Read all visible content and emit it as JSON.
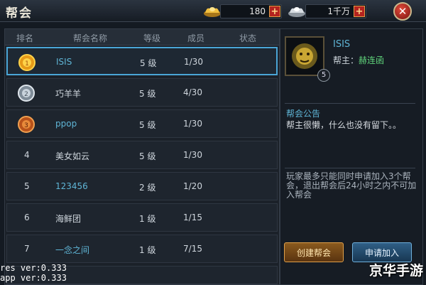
{
  "title": "帮会",
  "currency": {
    "gold": "180",
    "silver": "1千万",
    "plus_symbol": "+"
  },
  "close_symbol": "✕",
  "table": {
    "headers": [
      "排名",
      "帮会名称",
      "等级",
      "成员",
      "状态"
    ],
    "rows": [
      {
        "rank": "1",
        "name": "ISIS",
        "level": "5 级",
        "members": "1/30",
        "medal": "gold",
        "name_color": "cyan"
      },
      {
        "rank": "2",
        "name": "巧羊羊",
        "level": "5 级",
        "members": "4/30",
        "medal": "silver",
        "name_color": "white"
      },
      {
        "rank": "3",
        "name": "ppop",
        "level": "5 级",
        "members": "1/30",
        "medal": "bronze",
        "name_color": "cyan"
      },
      {
        "rank": "4",
        "name": "美女如云",
        "level": "5 级",
        "members": "1/30",
        "medal": "",
        "name_color": "white"
      },
      {
        "rank": "5",
        "name": "123456",
        "level": "2 级",
        "members": "1/20",
        "medal": "",
        "name_color": "cyan"
      },
      {
        "rank": "6",
        "name": "海鲜团",
        "level": "1 级",
        "members": "1/15",
        "medal": "",
        "name_color": "white"
      },
      {
        "rank": "7",
        "name": "一念之间",
        "level": "1 级",
        "members": "7/15",
        "medal": "",
        "name_color": "cyan"
      }
    ]
  },
  "detail": {
    "guild_name": "ISIS",
    "leader_label": "帮主：",
    "leader_name": "赫连函",
    "level_badge": "5",
    "announcement_title": "帮会公告",
    "announcement_text": "帮主很懒，什么也没有留下。。",
    "rule_text": "玩家最多只能同时申请加入3个帮会，退出帮会后24小时之内不可加入帮会",
    "create_button": "创建帮会",
    "apply_button": "申请加入"
  },
  "debug": {
    "res_ver": "res ver:0.333",
    "app_ver": "app ver:0.333"
  },
  "watermark": "京华手游",
  "colors": {
    "accent_cyan": "#5fb5d6",
    "leader_green": "#5fd27a",
    "selected_border": "#4aa5d6"
  }
}
